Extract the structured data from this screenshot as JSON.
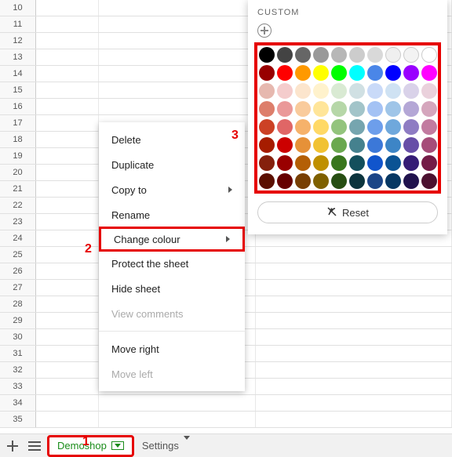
{
  "rows": [
    10,
    11,
    12,
    13,
    14,
    15,
    16,
    17,
    18,
    19,
    20,
    21,
    22,
    23,
    24,
    25,
    26,
    27,
    28,
    29,
    30,
    31,
    32,
    33,
    34,
    35
  ],
  "bottomBar": {
    "tabs": [
      {
        "label": "Demoshop",
        "active": true
      },
      {
        "label": "Settings",
        "active": false
      }
    ]
  },
  "menu": {
    "items": [
      {
        "label": "Delete",
        "sub": false,
        "disabled": false
      },
      {
        "label": "Duplicate",
        "sub": false,
        "disabled": false
      },
      {
        "label": "Copy to",
        "sub": true,
        "disabled": false
      },
      {
        "label": "Rename",
        "sub": false,
        "disabled": false
      },
      {
        "label": "Change colour",
        "sub": true,
        "disabled": false,
        "highlight": true
      },
      {
        "label": "Protect the sheet",
        "sub": false,
        "disabled": false
      },
      {
        "label": "Hide sheet",
        "sub": false,
        "disabled": false
      },
      {
        "label": "View comments",
        "sub": false,
        "disabled": true
      },
      {
        "label": "Move right",
        "sub": false,
        "disabled": false
      },
      {
        "label": "Move left",
        "sub": false,
        "disabled": true
      }
    ]
  },
  "colorPanel": {
    "header": "CUSTOM",
    "reset": "Reset",
    "colors": [
      "#000000",
      "#434343",
      "#666666",
      "#999999",
      "#b7b7b7",
      "#cccccc",
      "#d9d9d9",
      "#efefef",
      "#f3f3f3",
      "#ffffff",
      "#980000",
      "#ff0000",
      "#ff9900",
      "#ffff00",
      "#00ff00",
      "#00ffff",
      "#4a86e8",
      "#0000ff",
      "#9900ff",
      "#ff00ff",
      "#e6b8af",
      "#f4cccc",
      "#fce5cd",
      "#fff2cc",
      "#d9ead3",
      "#d0e0e3",
      "#c9daf8",
      "#cfe2f3",
      "#d9d2e9",
      "#ead1dc",
      "#dd7e6b",
      "#ea9999",
      "#f9cb9c",
      "#ffe599",
      "#b6d7a8",
      "#a2c4c9",
      "#a4c2f4",
      "#9fc5e8",
      "#b4a7d6",
      "#d5a6bd",
      "#cc4125",
      "#e06666",
      "#f6b26b",
      "#ffd966",
      "#93c47d",
      "#76a5af",
      "#6d9eeb",
      "#6fa8dc",
      "#8e7cc3",
      "#c27ba0",
      "#a61c00",
      "#cc0000",
      "#e69138",
      "#f1c232",
      "#6aa84f",
      "#45818e",
      "#3c78d8",
      "#3d85c6",
      "#674ea7",
      "#a64d79",
      "#85200c",
      "#990000",
      "#b45f06",
      "#bf9000",
      "#38761d",
      "#134f5c",
      "#1155cc",
      "#0b5394",
      "#351c75",
      "#741b47",
      "#5b0f00",
      "#660000",
      "#783f04",
      "#7f6000",
      "#274e13",
      "#0c343d",
      "#1c4587",
      "#073763",
      "#20124d",
      "#4c1130"
    ]
  },
  "annotations": {
    "a1": "1",
    "a2": "2",
    "a3": "3"
  }
}
